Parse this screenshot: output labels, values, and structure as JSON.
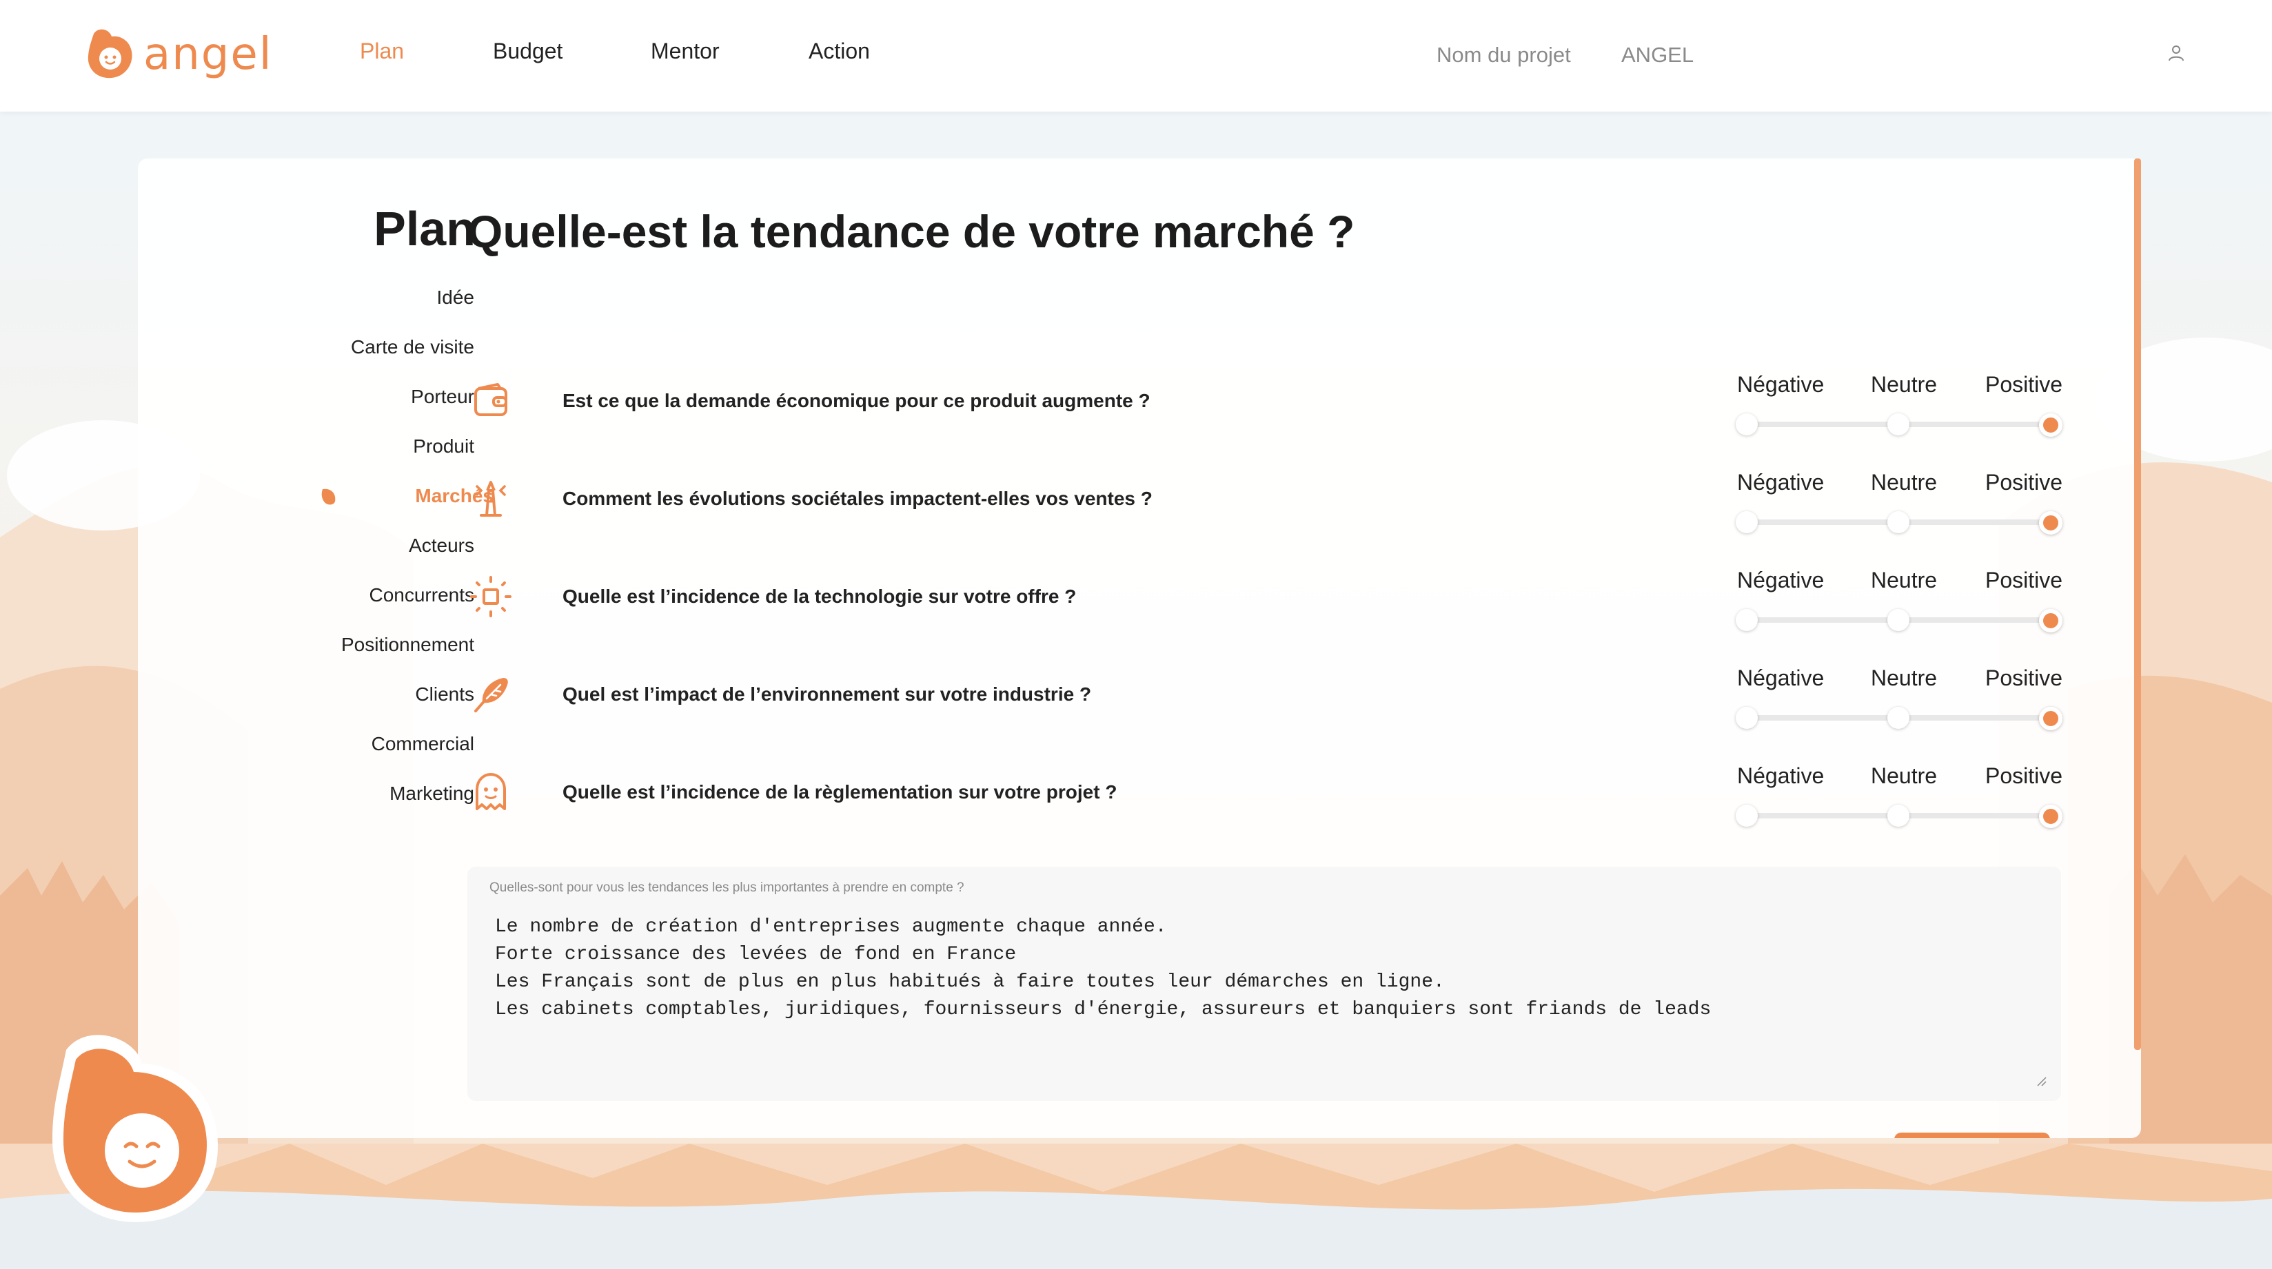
{
  "app": {
    "logo_text": "angel"
  },
  "nav": {
    "items": [
      {
        "label": "Plan",
        "active": true
      },
      {
        "label": "Budget",
        "active": false
      },
      {
        "label": "Mentor",
        "active": false
      },
      {
        "label": "Action",
        "active": false
      }
    ]
  },
  "project": {
    "label": "Nom du projet",
    "name": "ANGEL"
  },
  "sidebar": {
    "title": "Plan",
    "items": [
      {
        "label": "Idée"
      },
      {
        "label": "Carte de visite"
      },
      {
        "label": "Porteur"
      },
      {
        "label": "Produit"
      },
      {
        "label": "Marchés",
        "active": true
      },
      {
        "label": "Acteurs"
      },
      {
        "label": "Concurrents"
      },
      {
        "label": "Positionnement"
      },
      {
        "label": "Clients"
      },
      {
        "label": "Commercial"
      },
      {
        "label": "Marketing"
      }
    ]
  },
  "main": {
    "title": "Quelle-est la tendance de votre marché ?",
    "scale_labels": [
      "Négative",
      "Neutre",
      "Positive"
    ],
    "questions": [
      {
        "text": "Est ce que la demande économique pour ce produit augmente ?",
        "icon": "wallet-icon",
        "value": "Positive"
      },
      {
        "text": "Comment les évolutions sociétales impactent-elles vos ventes ?",
        "icon": "lighthouse-icon",
        "value": "Positive"
      },
      {
        "text": "Quelle est l’incidence de la technologie sur votre offre ?",
        "icon": "chip-icon",
        "value": "Positive"
      },
      {
        "text": "Quel est l’impact de l’environnement sur votre industrie ?",
        "icon": "feather-icon",
        "value": "Positive"
      },
      {
        "text": "Quelle est l’incidence de la règlementation sur votre projet ?",
        "icon": "ghost-icon",
        "value": "Positive"
      }
    ],
    "trends": {
      "label": "Quelles-sont pour vous les tendances les plus importantes à prendre en compte ?",
      "lines": [
        "Le nombre de création d'entreprises augmente chaque année.",
        "Forte croissance des levées de fond en France",
        "Les Français sont de plus en plus habitués à faire toutes leur démarches en ligne.",
        "Les cabinets comptables, juridiques, fournisseurs d'énergie, assureurs et banquiers sont friands de leads"
      ]
    }
  },
  "colors": {
    "accent": "#ef8a4f",
    "text": "#222222",
    "muted": "#8a8a8a"
  }
}
